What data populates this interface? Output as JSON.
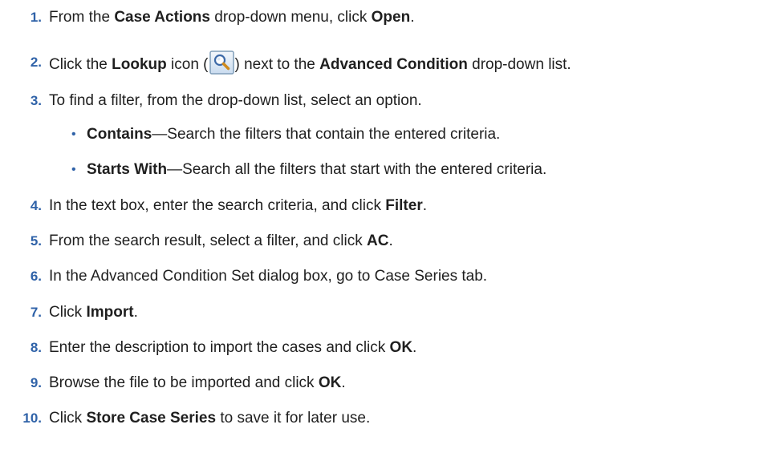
{
  "steps": [
    {
      "num": "1.",
      "parts": [
        "From the ",
        "Case Actions",
        " drop-down menu, click ",
        "Open",
        "."
      ]
    },
    {
      "num": "2.",
      "parts": [
        "Click the ",
        "Lookup",
        " icon (",
        ") next to the ",
        "Advanced Condition",
        " drop-down list."
      ],
      "icon": "magnifier-lookup-icon"
    },
    {
      "num": "3.",
      "parts": [
        "To find a filter, from the drop-down list, select an option."
      ]
    },
    {
      "num": "4.",
      "parts": [
        "In the text box, enter the search criteria, and click ",
        "Filter",
        "."
      ]
    },
    {
      "num": "5.",
      "parts": [
        "From the search result, select a filter, and click ",
        "AC",
        "."
      ]
    },
    {
      "num": "6.",
      "parts": [
        "In the Advanced Condition Set dialog box, go to Case Series tab."
      ]
    },
    {
      "num": "7.",
      "parts": [
        "Click ",
        "Import",
        "."
      ]
    },
    {
      "num": "8.",
      "parts": [
        "Enter the description to import the cases and click ",
        "OK",
        "."
      ]
    },
    {
      "num": "9.",
      "parts": [
        "Browse the file to be imported and click ",
        "OK",
        "."
      ]
    },
    {
      "num": "10.",
      "parts": [
        "Click ",
        "Store Case Series",
        " to save it for later use."
      ]
    }
  ],
  "bullets": [
    {
      "mark": "•",
      "parts": [
        "Contains",
        "—Search the filters that contain the entered criteria."
      ]
    },
    {
      "mark": "•",
      "parts": [
        "Starts With",
        "—Search all the filters that start with the entered criteria."
      ]
    }
  ],
  "colors": {
    "number": "#2f62a8",
    "text": "#1f1f1f",
    "icon_border": "#7f9db9",
    "icon_fill": "#dce8f5"
  }
}
